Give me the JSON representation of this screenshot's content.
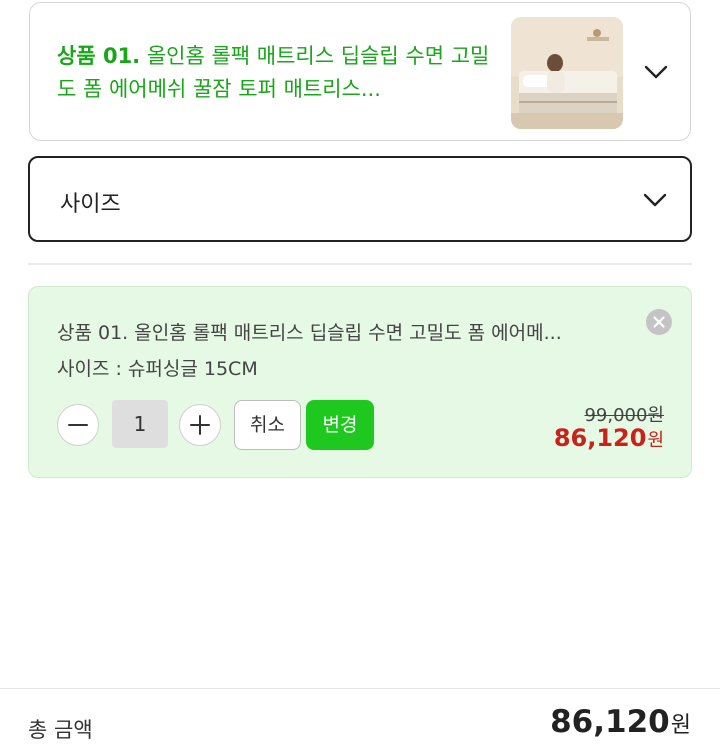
{
  "product": {
    "number_label": "상품 01.",
    "name": "올인홈 롤팩 매트리스 딥슬립 수면 고밀도 폼 에어메쉬 꿀잠 토퍼 매트리스...",
    "image_alt": "mattress-photo",
    "accent_color": "#19a619"
  },
  "size_select": {
    "label": "사이즈"
  },
  "selected_item": {
    "title": "상품 01. 올인홈 롤팩 매트리스 딥슬립 수면 고밀도 폼 에어메...",
    "option": "사이즈 : 슈퍼싱글 15CM",
    "quantity": "1",
    "cancel_label": "취소",
    "change_label": "변경",
    "original_price": "99,000원",
    "sale_price_amount": "86,120",
    "sale_price_unit": "원"
  },
  "total": {
    "label": "총 금액",
    "amount": "86,120",
    "unit": "원"
  },
  "icons": {
    "product_expand": "chevron-down-icon",
    "size_expand": "chevron-down-icon",
    "remove": "close-icon",
    "decrease": "minus-icon",
    "increase": "plus-icon"
  },
  "colors": {
    "selected_bg": "#e6f9e4",
    "change_button": "#1ec81e",
    "sale_price": "#c8221a"
  }
}
